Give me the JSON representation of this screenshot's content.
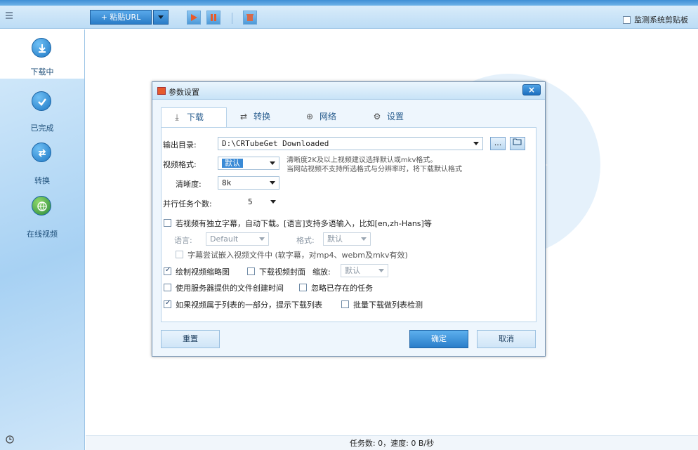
{
  "toolbar": {
    "paste_url": "+ 粘贴URL",
    "monitor_clipboard": "监测系统剪贴板"
  },
  "sidebar": {
    "items": [
      {
        "label": "下载中",
        "icon": "download-icon"
      },
      {
        "label": "已完成",
        "icon": "check-icon"
      },
      {
        "label": "转换",
        "icon": "convert-icon"
      },
      {
        "label": "在线视频",
        "icon": "globe-icon"
      }
    ]
  },
  "dialog": {
    "title": "参数设置",
    "close": "×",
    "tabs": [
      {
        "label": "下载",
        "icon": "download-tab-icon",
        "glyph": "⤓"
      },
      {
        "label": "转换",
        "icon": "convert-tab-icon",
        "glyph": "⇄"
      },
      {
        "label": "网络",
        "icon": "network-tab-icon",
        "glyph": "⊕"
      },
      {
        "label": "设置",
        "icon": "settings-tab-icon",
        "glyph": "⚙"
      }
    ],
    "output_dir_label": "输出目录:",
    "output_dir_value": "D:\\CRTubeGet Downloaded",
    "more_btn": "...",
    "video_format_label": "视频格式:",
    "video_format_value": "默认",
    "format_hint_line1": "清晰度2K及以上视频建议选择默认或mkv格式。",
    "format_hint_line2": "当网站视频不支持所选格式与分辨率时，将下载默认格式",
    "resolution_label": "清晰度:",
    "resolution_value": "8k",
    "parallel_label": "并行任务个数:",
    "parallel_value": "5",
    "subtitle_check": "若视频有独立字幕，自动下载。[语言]支持多语输入，比如[en,zh-Hans]等",
    "language_label": "语言:",
    "language_value": "Default",
    "sub_format_label": "格式:",
    "sub_format_value": "默认",
    "embed_subtitle": "字幕尝试嵌入视频文件中 (软字幕，对mp4、webm及mkv有效)",
    "draw_thumbnail": "绘制视频缩略图",
    "download_cover": "下载视频封面",
    "zoom_label": "缩放:",
    "zoom_value": "默认",
    "server_time": "使用服务器提供的文件创建时间",
    "ignore_existing": "忽略已存在的任务",
    "playlist_prompt": "如果视频属于列表的一部分，提示下载列表",
    "batch_check": "批量下载做列表检测",
    "reset_btn": "重置",
    "ok_btn": "确定",
    "cancel_btn": "取消"
  },
  "status": {
    "text": "任务数: 0，速度: 0 B/秒"
  }
}
